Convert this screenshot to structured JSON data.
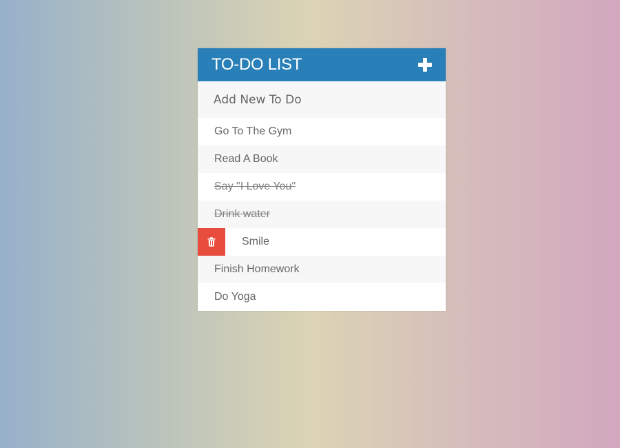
{
  "header": {
    "title": "TO-DO LIST",
    "add_icon": "plus-icon"
  },
  "new_todo": {
    "placeholder": "Add New To Do"
  },
  "todos": [
    {
      "label": "Go To The Gym",
      "completed": false
    },
    {
      "label": "Read A Book",
      "completed": false
    },
    {
      "label": "Say \"I Love You\"",
      "completed": true
    },
    {
      "label": "Drink water",
      "completed": true
    },
    {
      "label": "Smile",
      "completed": false,
      "delete_visible": true,
      "delete_icon": "trash-icon"
    },
    {
      "label": "Finish Homework",
      "completed": false
    },
    {
      "label": "Do Yoga",
      "completed": false
    }
  ],
  "colors": {
    "header_bg": "#2980b9",
    "delete_bg": "#e74c3c",
    "text": "#666666"
  }
}
